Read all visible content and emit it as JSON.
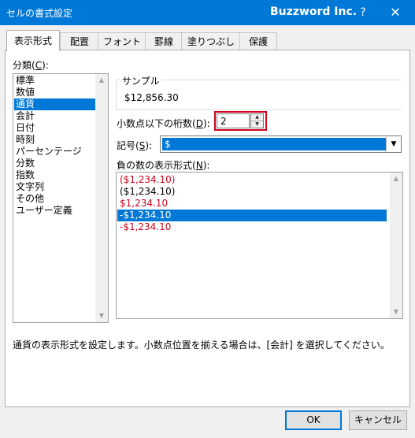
{
  "window": {
    "title": "セルの書式設定",
    "brand": "Buzzword Inc.",
    "help_label": "?",
    "close_label": "✕"
  },
  "tabs": [
    {
      "label": "表示形式",
      "active": true
    },
    {
      "label": "配置"
    },
    {
      "label": "フォント"
    },
    {
      "label": "罫線"
    },
    {
      "label": "塗りつぶし"
    },
    {
      "label": "保護"
    }
  ],
  "category": {
    "label": "分類",
    "accesskey": "C",
    "items": [
      "標準",
      "数値",
      "通貨",
      "会計",
      "日付",
      "時刻",
      "パーセンテージ",
      "分数",
      "指数",
      "文字列",
      "その他",
      "ユーザー定義"
    ],
    "selected_index": 2
  },
  "sample": {
    "label": "サンプル",
    "value": "$12,856.30"
  },
  "decimal": {
    "label": "小数点以下の桁数",
    "accesskey": "D",
    "value": "2"
  },
  "symbol": {
    "label": "記号",
    "accesskey": "S",
    "value": "$"
  },
  "negative": {
    "label": "負の数の表示形式",
    "accesskey": "N",
    "items": [
      {
        "text": "($1,234.10)",
        "color": "#d0021b"
      },
      {
        "text": "($1,234.10)",
        "color": "#000000"
      },
      {
        "text": "$1,234.10",
        "color": "#d0021b"
      },
      {
        "text": "-$1,234.10",
        "color": "#000000"
      },
      {
        "text": "-$1,234.10",
        "color": "#d0021b"
      }
    ],
    "selected_index": 3
  },
  "description": "通貨の表示形式を設定します。小数点位置を揃える場合は、[会計] を選択してください。",
  "buttons": {
    "ok": "OK",
    "cancel": "キャンセル"
  },
  "colors": {
    "accent": "#0078d7",
    "highlight_border": "#d0021b"
  }
}
